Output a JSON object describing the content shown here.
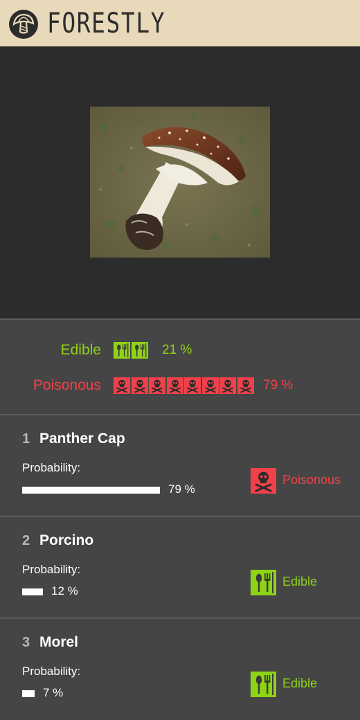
{
  "app": {
    "title": "FORESTLY",
    "logo_icon": "mushroom-logo-icon"
  },
  "photo": {
    "subject": "mushroom-photo"
  },
  "summary": {
    "edible": {
      "label": "Edible",
      "percent": "21 %",
      "value": 21,
      "icon": "cutlery-icon",
      "color": "#8fd315"
    },
    "poisonous": {
      "label": "Poisonous",
      "percent": "79 %",
      "value": 79,
      "icon": "skull-crossbones-icon",
      "color": "#f0414a"
    }
  },
  "results": [
    {
      "rank": "1",
      "name": "Panther Cap",
      "probability_label": "Probability:",
      "percent": "79 %",
      "value": 79,
      "class_label": "Poisonous",
      "class_icon": "skull-crossbones-icon",
      "class_color": "#f0414a"
    },
    {
      "rank": "2",
      "name": "Porcino",
      "probability_label": "Probability:",
      "percent": "12 %",
      "value": 12,
      "class_label": "Edible",
      "class_icon": "cutlery-icon",
      "class_color": "#8fd315"
    },
    {
      "rank": "3",
      "name": "Morel",
      "probability_label": "Probability:",
      "percent": "7 %",
      "value": 7,
      "class_label": "Edible",
      "class_icon": "cutlery-icon",
      "class_color": "#8fd315"
    }
  ]
}
